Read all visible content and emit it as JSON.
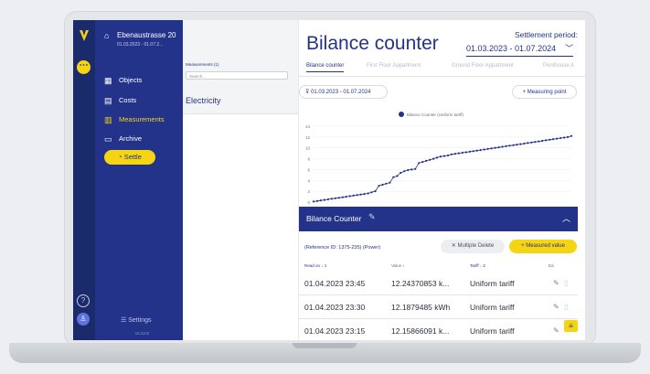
{
  "property": {
    "name": "Ebenaustrasse 20",
    "date_range": "01.03.2023 - 01.07.2..."
  },
  "nav": [
    {
      "label": "Objects",
      "icon": "building-icon"
    },
    {
      "label": "Costs",
      "icon": "receipt-icon"
    },
    {
      "label": "Measurements",
      "icon": "bar-chart-icon"
    },
    {
      "label": "Archive",
      "icon": "archive-icon"
    }
  ],
  "active_nav": "Measurements",
  "settle_label": "Settle",
  "settings_label": "Settings",
  "version": "v2.22.9",
  "measurement_list": {
    "title": "Measurements (1)",
    "search_placeholder": "Search...",
    "items": [
      "Electricity"
    ]
  },
  "header": {
    "title": "Bilance counter",
    "period_label": "Settlement period:",
    "period_value": "01.03.2023 - 01.07.2024",
    "tabs": [
      "Bilance counter",
      "First Floor Appartment",
      "Ground Floor Appartment",
      "Penthouse A"
    ]
  },
  "filter_label": "01.03.2023 - 01.07.2024",
  "measuring_point_label": "+ Measuring point",
  "chart_data": {
    "type": "line",
    "series": [
      {
        "name": "Bilance Counter (Uniform tariff)",
        "color": "#23338a",
        "x": [
          0,
          4,
          8,
          12,
          16,
          20,
          24,
          28,
          32,
          36,
          40,
          44,
          48,
          52,
          56,
          60,
          64,
          68,
          72,
          76,
          80,
          84,
          88,
          92,
          96,
          100,
          104,
          108,
          112,
          116,
          120,
          124,
          128,
          132,
          136,
          140,
          144,
          148,
          152,
          156,
          160,
          164,
          168,
          172,
          176,
          180,
          184,
          188,
          192,
          196,
          200,
          204,
          208,
          212,
          216,
          220,
          224,
          228,
          232,
          236,
          240,
          244,
          248,
          252,
          256,
          260,
          264,
          268,
          272,
          276,
          280,
          284
        ],
        "values": [
          0.1,
          0.2,
          0.3,
          0.4,
          0.5,
          0.6,
          0.7,
          0.8,
          0.9,
          1.0,
          1.1,
          1.2,
          1.3,
          1.4,
          1.5,
          1.6,
          1.8,
          2.0,
          3.0,
          3.2,
          3.4,
          3.6,
          4.6,
          4.8,
          5.4,
          5.7,
          5.9,
          6.0,
          6.1,
          7.2,
          7.4,
          7.6,
          7.8,
          8.0,
          8.2,
          8.4,
          8.5,
          8.6,
          8.8,
          8.9,
          9.0,
          9.1,
          9.2,
          9.3,
          9.4,
          9.5,
          9.6,
          9.7,
          9.8,
          9.9,
          10.0,
          10.1,
          10.2,
          10.3,
          10.4,
          10.5,
          10.6,
          10.7,
          10.8,
          10.9,
          11.0,
          11.1,
          11.2,
          11.3,
          11.4,
          11.5,
          11.6,
          11.7,
          11.8,
          11.9,
          12.0,
          12.2
        ]
      }
    ],
    "yticks": [
      0,
      2,
      4,
      6,
      8,
      10,
      12,
      14
    ],
    "ylim": [
      0,
      14
    ],
    "legend": "top-center"
  },
  "panel": {
    "title": "Bilance Counter",
    "reference": "(Reference ID: 1375-235) (Power)",
    "multiple_delete_label": "Multiple Delete",
    "measured_value_label": "+ Measured value",
    "columns": [
      "Read on ↓ 1",
      "Value ↕",
      "Tariff ↓ 2",
      "Ed."
    ],
    "rows": [
      {
        "read_on": "01.04.2023 23:45",
        "value": "12.24370853 k...",
        "tariff": "Uniform tariff"
      },
      {
        "read_on": "01.04.2023 23:30",
        "value": "12.1879485 kWh",
        "tariff": "Uniform tariff"
      },
      {
        "read_on": "01.04.2023 23:15",
        "value": "12.15866091 k...",
        "tariff": "Uniform tariff"
      }
    ]
  }
}
